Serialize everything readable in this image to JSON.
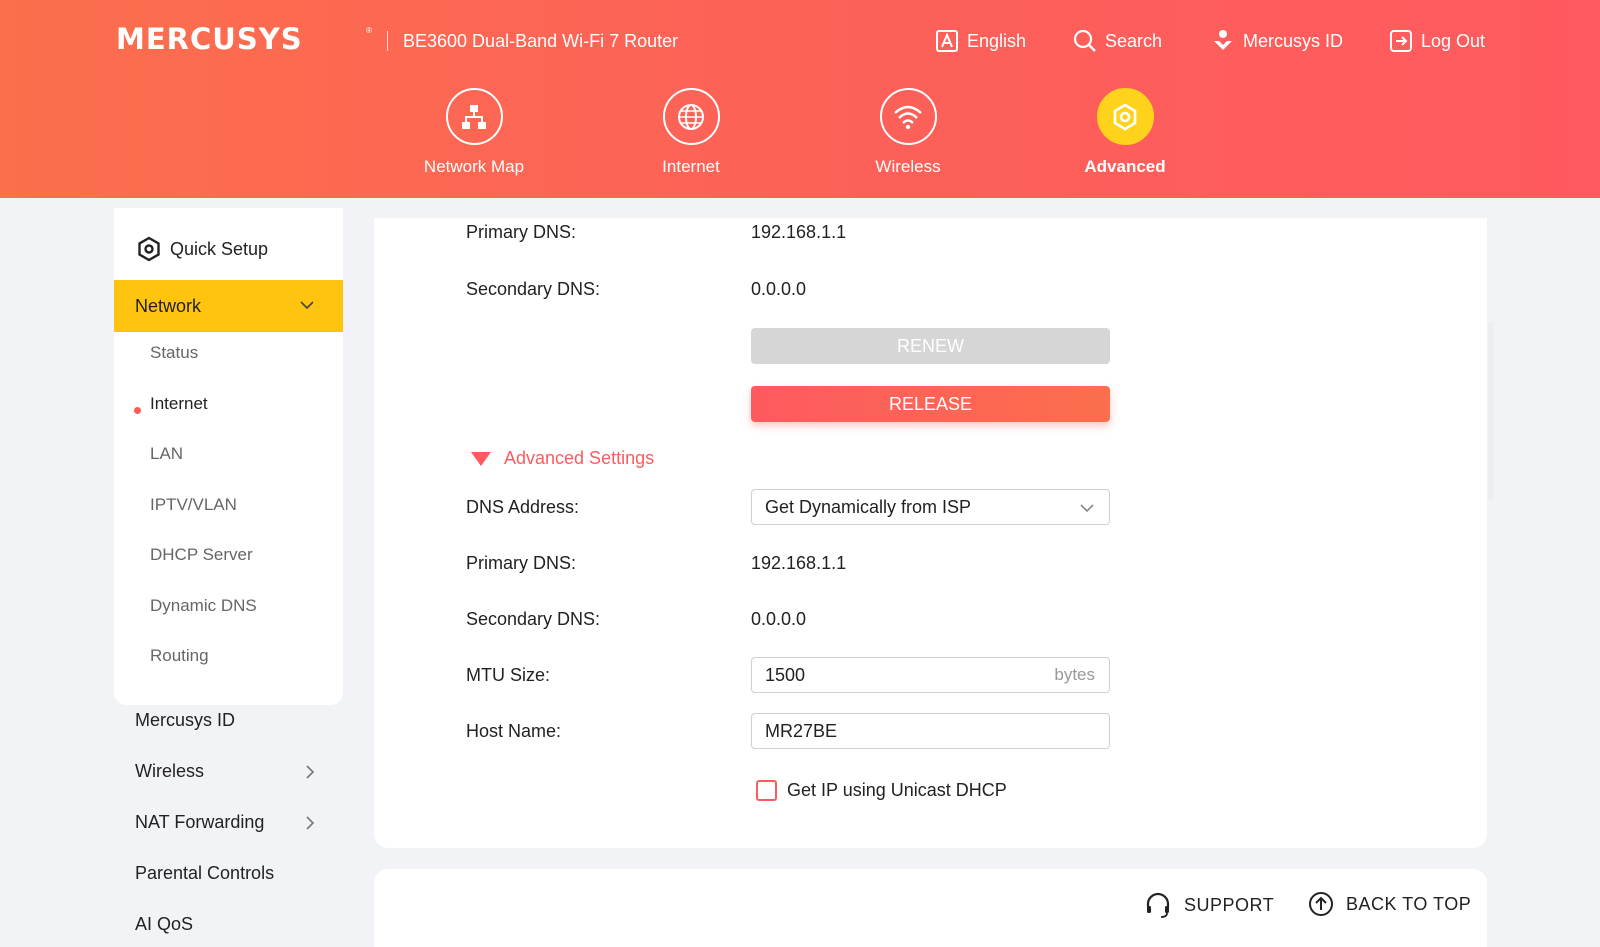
{
  "header": {
    "logo": "MERCUSYS",
    "logo_mark": "®",
    "model": "BE3600 Dual-Band Wi-Fi 7 Router",
    "links": {
      "language": "English",
      "search": "Search",
      "account": "Mercusys ID",
      "logout": "Log Out"
    },
    "nav": [
      {
        "label": "Network Map",
        "icon": "network-map-icon"
      },
      {
        "label": "Internet",
        "icon": "globe-icon"
      },
      {
        "label": "Wireless",
        "icon": "wifi-icon"
      },
      {
        "label": "Advanced",
        "icon": "gear-icon",
        "active": true
      }
    ]
  },
  "sidebar": {
    "quick_setup": "Quick Setup",
    "network": "Network",
    "network_sub": [
      "Status",
      "Internet",
      "LAN",
      "IPTV/VLAN",
      "DHCP Server",
      "Dynamic DNS",
      "Routing"
    ],
    "active_sub": "Internet",
    "items": [
      "Mercusys ID",
      "Wireless",
      "NAT Forwarding",
      "Parental Controls",
      "AI QoS"
    ]
  },
  "content": {
    "primary_dns_label": "Primary DNS:",
    "primary_dns_value": "192.168.1.1",
    "secondary_dns_label": "Secondary DNS:",
    "secondary_dns_value": "0.0.0.0",
    "renew_label": "RENEW",
    "release_label": "RELEASE",
    "advanced_settings": "Advanced Settings",
    "dns_address_label": "DNS Address:",
    "dns_address_value": "Get Dynamically from ISP",
    "adv_primary_dns_label": "Primary DNS:",
    "adv_primary_dns_value": "192.168.1.1",
    "adv_secondary_dns_label": "Secondary DNS:",
    "adv_secondary_dns_value": "0.0.0.0",
    "mtu_label": "MTU Size:",
    "mtu_value": "1500",
    "mtu_suffix": "bytes",
    "host_label": "Host Name:",
    "host_value": "MR27BE",
    "unicast_label": "Get IP using Unicast DHCP",
    "unicast_checked": false
  },
  "footer": {
    "support": "SUPPORT",
    "back_to_top": "BACK TO TOP"
  },
  "colors": {
    "accent": "#fe5a5f",
    "highlight": "#ffc410",
    "nav_active": "#ffd21c"
  }
}
